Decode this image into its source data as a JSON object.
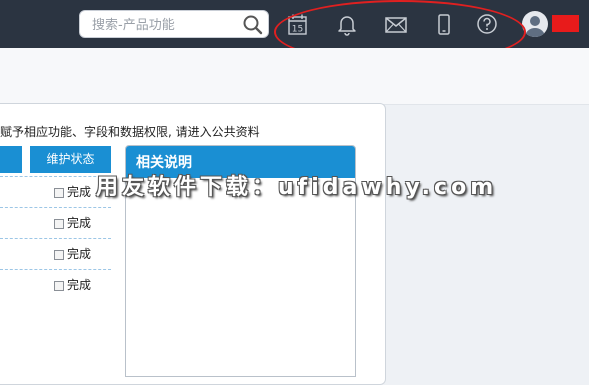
{
  "topbar": {
    "search_placeholder": "搜索-产品功能",
    "calendar_day": "15",
    "icons": [
      "search-icon",
      "calendar-icon",
      "bell-icon",
      "mail-icon",
      "phone-icon",
      "help-icon",
      "avatar-icon"
    ],
    "accent": "#1a8fd3",
    "bar_color": "#2b3441"
  },
  "main": {
    "description": "赋予相应功能、字段和数据权限, 请进入公共资料",
    "table": {
      "status_header": "维护状态",
      "rows": [
        {
          "status": "完成"
        },
        {
          "status": "完成"
        },
        {
          "status": "完成"
        },
        {
          "status": "完成"
        }
      ]
    },
    "related": {
      "title": "相关说明"
    }
  },
  "watermark": "用友软件下载：ufidawhy.com"
}
